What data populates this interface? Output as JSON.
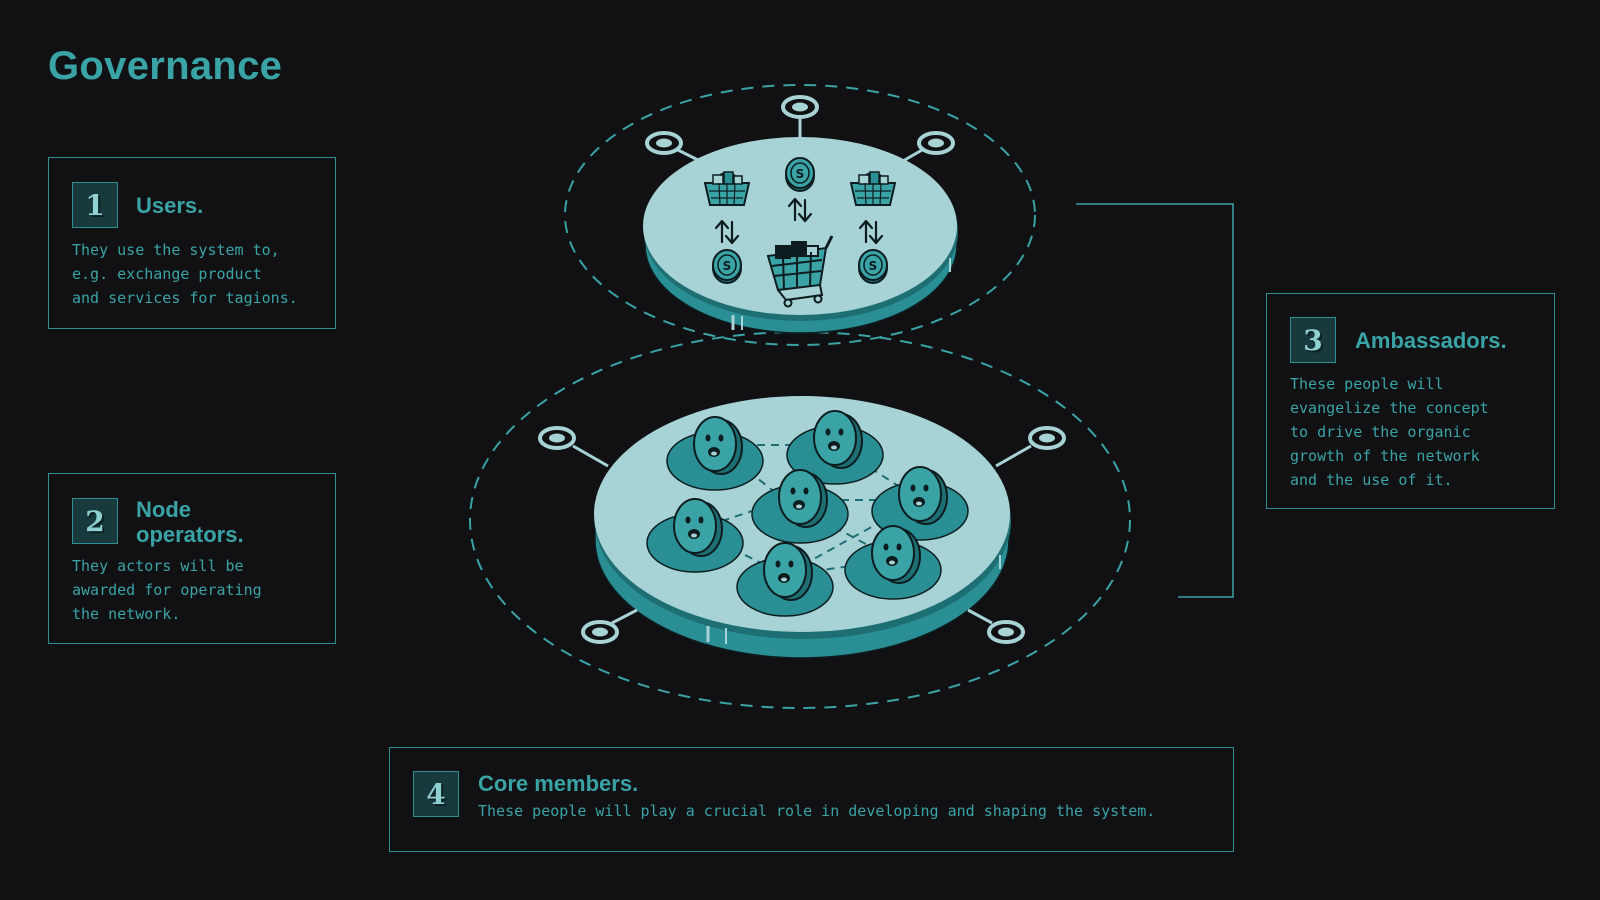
{
  "page": {
    "title": "Governance"
  },
  "cards": {
    "users": {
      "number": "1",
      "title": "Users.",
      "description": "They use the system to,\ne.g. exchange product\nand services for tagions."
    },
    "node_operators": {
      "number": "2",
      "title": "Node\noperators.",
      "description": "They actors will be\nawarded for operating\nthe network."
    },
    "ambassadors": {
      "number": "3",
      "title": "Ambassadors.",
      "description": "These people will\nevangelize the concept\nto drive the organic\ngrowth of the network\nand the use of it."
    },
    "core_members": {
      "number": "4",
      "title": "Core members.",
      "description": "These people will play a crucial role in developing and shaping the system."
    }
  },
  "colors": {
    "background": "#111113",
    "accent": "#3aa3a6",
    "platform": "#a8d3d6",
    "dark_teal": "#2a8f94"
  },
  "icons": [
    "basket-icon",
    "coin-icon",
    "exchange-arrows-icon",
    "shopping-cart-icon",
    "smiley-token-icon",
    "node-pin-icon"
  ]
}
